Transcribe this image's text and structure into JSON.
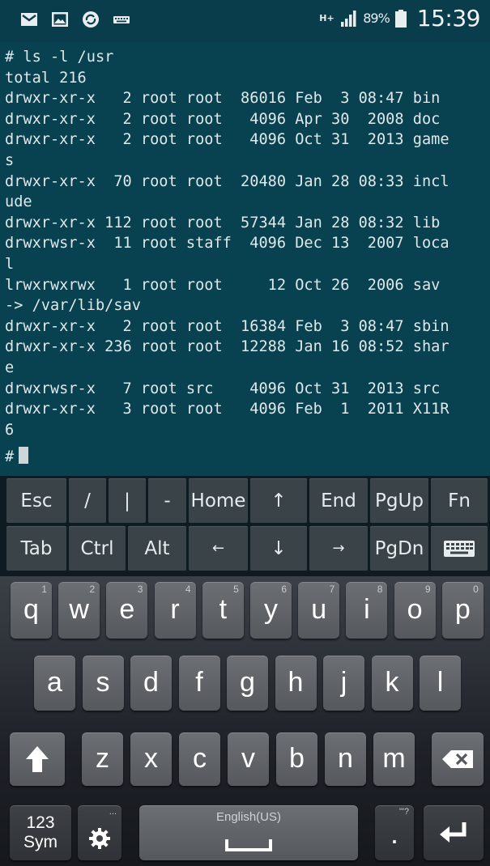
{
  "status_bar": {
    "icons_left": [
      "mail-icon",
      "image-icon",
      "sync-icon",
      "keyboard-icon"
    ],
    "network_type": "H+",
    "battery_percent": "89%",
    "time": "15:39"
  },
  "terminal": {
    "lines": [
      "# ls -l /usr",
      "total 216",
      "drwxr-xr-x   2 root root  86016 Feb  3 08:47 bin",
      "drwxr-xr-x   2 root root   4096 Apr 30  2008 doc",
      "drwxr-xr-x   2 root root   4096 Oct 31  2013 game",
      "s",
      "drwxr-xr-x  70 root root  20480 Jan 28 08:33 incl",
      "ude",
      "drwxr-xr-x 112 root root  57344 Jan 28 08:32 lib",
      "drwxrwsr-x  11 root staff  4096 Dec 13  2007 loca",
      "l",
      "lrwxrwxrwx   1 root root     12 Oct 26  2006 sav",
      "-> /var/lib/sav",
      "drwxr-xr-x   2 root root  16384 Feb  3 08:47 sbin",
      "drwxr-xr-x 236 root root  12288 Jan 16 08:52 shar",
      "e",
      "drwxrwsr-x   7 root src    4096 Oct 31  2013 src",
      "drwxr-xr-x   3 root root   4096 Feb  1  2011 X11R",
      "6"
    ],
    "prompt": "#"
  },
  "extra_keys": {
    "row1": [
      "Esc",
      "/",
      "|",
      "-",
      "Home",
      "↑",
      "End",
      "PgUp",
      "Fn"
    ],
    "row2": [
      "Tab",
      "Ctrl",
      "Alt",
      "←",
      "↓",
      "→",
      "PgDn",
      "keyboard-toggle-icon"
    ]
  },
  "keyboard": {
    "row1": [
      {
        "key": "q",
        "sub": "1"
      },
      {
        "key": "w",
        "sub": "2"
      },
      {
        "key": "e",
        "sub": "3"
      },
      {
        "key": "r",
        "sub": "4"
      },
      {
        "key": "t",
        "sub": "5"
      },
      {
        "key": "y",
        "sub": "6"
      },
      {
        "key": "u",
        "sub": "7"
      },
      {
        "key": "i",
        "sub": "8"
      },
      {
        "key": "o",
        "sub": "9"
      },
      {
        "key": "p",
        "sub": "0"
      }
    ],
    "row2": [
      "a",
      "s",
      "d",
      "f",
      "g",
      "h",
      "j",
      "k",
      "l"
    ],
    "row3": [
      "z",
      "x",
      "c",
      "v",
      "b",
      "n",
      "m"
    ],
    "sym_label_line1": "123",
    "sym_label_line2": "Sym",
    "settings_sub": "...",
    "space_label": "English(US)",
    "period_key": ".",
    "period_sub": "'\"?",
    "icons": [
      "shift-icon",
      "backspace-icon",
      "settings-icon",
      "space-icon",
      "enter-icon"
    ]
  },
  "colors": {
    "terminal_bg": "#08414f",
    "terminal_text": "#dfe8ea",
    "status_bar_bg": "#0a3d4b",
    "extra_key_bg": "#3a4348",
    "keyboard_key_bg": "#5f6368"
  }
}
